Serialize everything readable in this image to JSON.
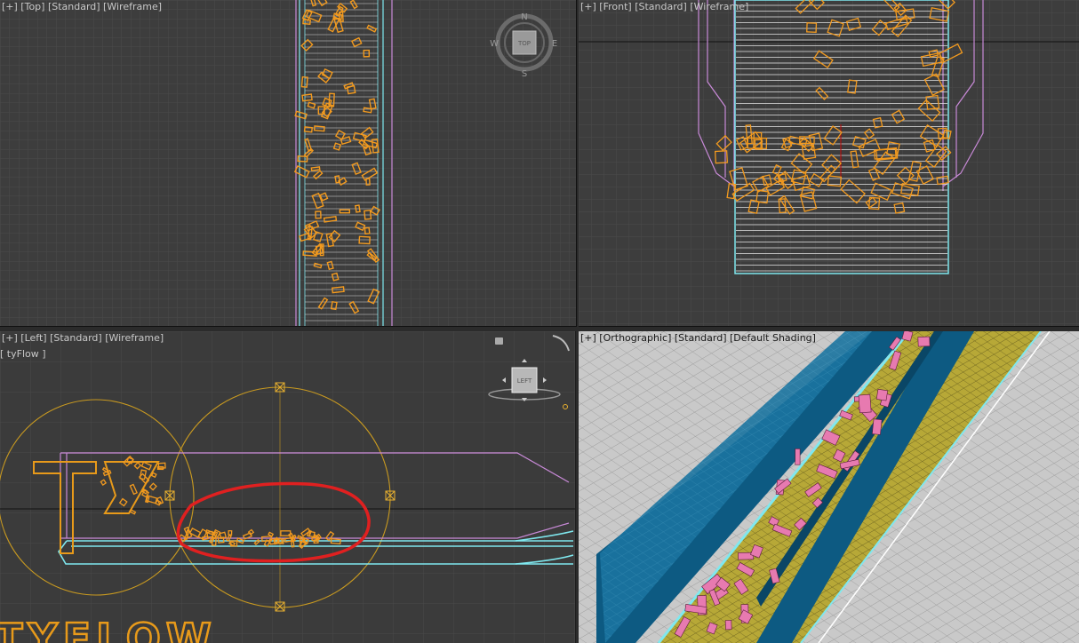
{
  "viewports": {
    "top": {
      "label": "[+] [Top] [Standard] [Wireframe]"
    },
    "front": {
      "label": "[+] [Front] [Standard] [Wireframe]"
    },
    "left": {
      "label": "[+] [Left] [Standard] [Wireframe]",
      "sublabel": "[ tyFlow ]"
    },
    "persp": {
      "label": "[+] [Orthographic] [Standard] [Default Shading]"
    }
  },
  "viewcube": {
    "top_face": "TOP",
    "left_face": "LEFT",
    "compass": {
      "n": "N",
      "s": "S",
      "e": "E",
      "w": "W"
    }
  },
  "logo_text": "TYFLOW",
  "colors": {
    "viewport_bg": "#3d3d3d",
    "grid": "#4a4a4a",
    "particles": "#f29a1f",
    "particles_shaded": "#e77ab0",
    "conveyor_outline": "#7fe8ef",
    "container_outline": "#c98ad8",
    "emitter_circle": "#c99a20",
    "annotation_red": "#e02020",
    "active_border": "#b59a2a",
    "shaded_wall": "#0d5a82",
    "shaded_belt": "#b7a837"
  },
  "icons": [
    "viewcube-compass-icon",
    "viewcube-left-icon",
    "orbit-icon",
    "lock-icon",
    "emitter-handle-icon"
  ]
}
